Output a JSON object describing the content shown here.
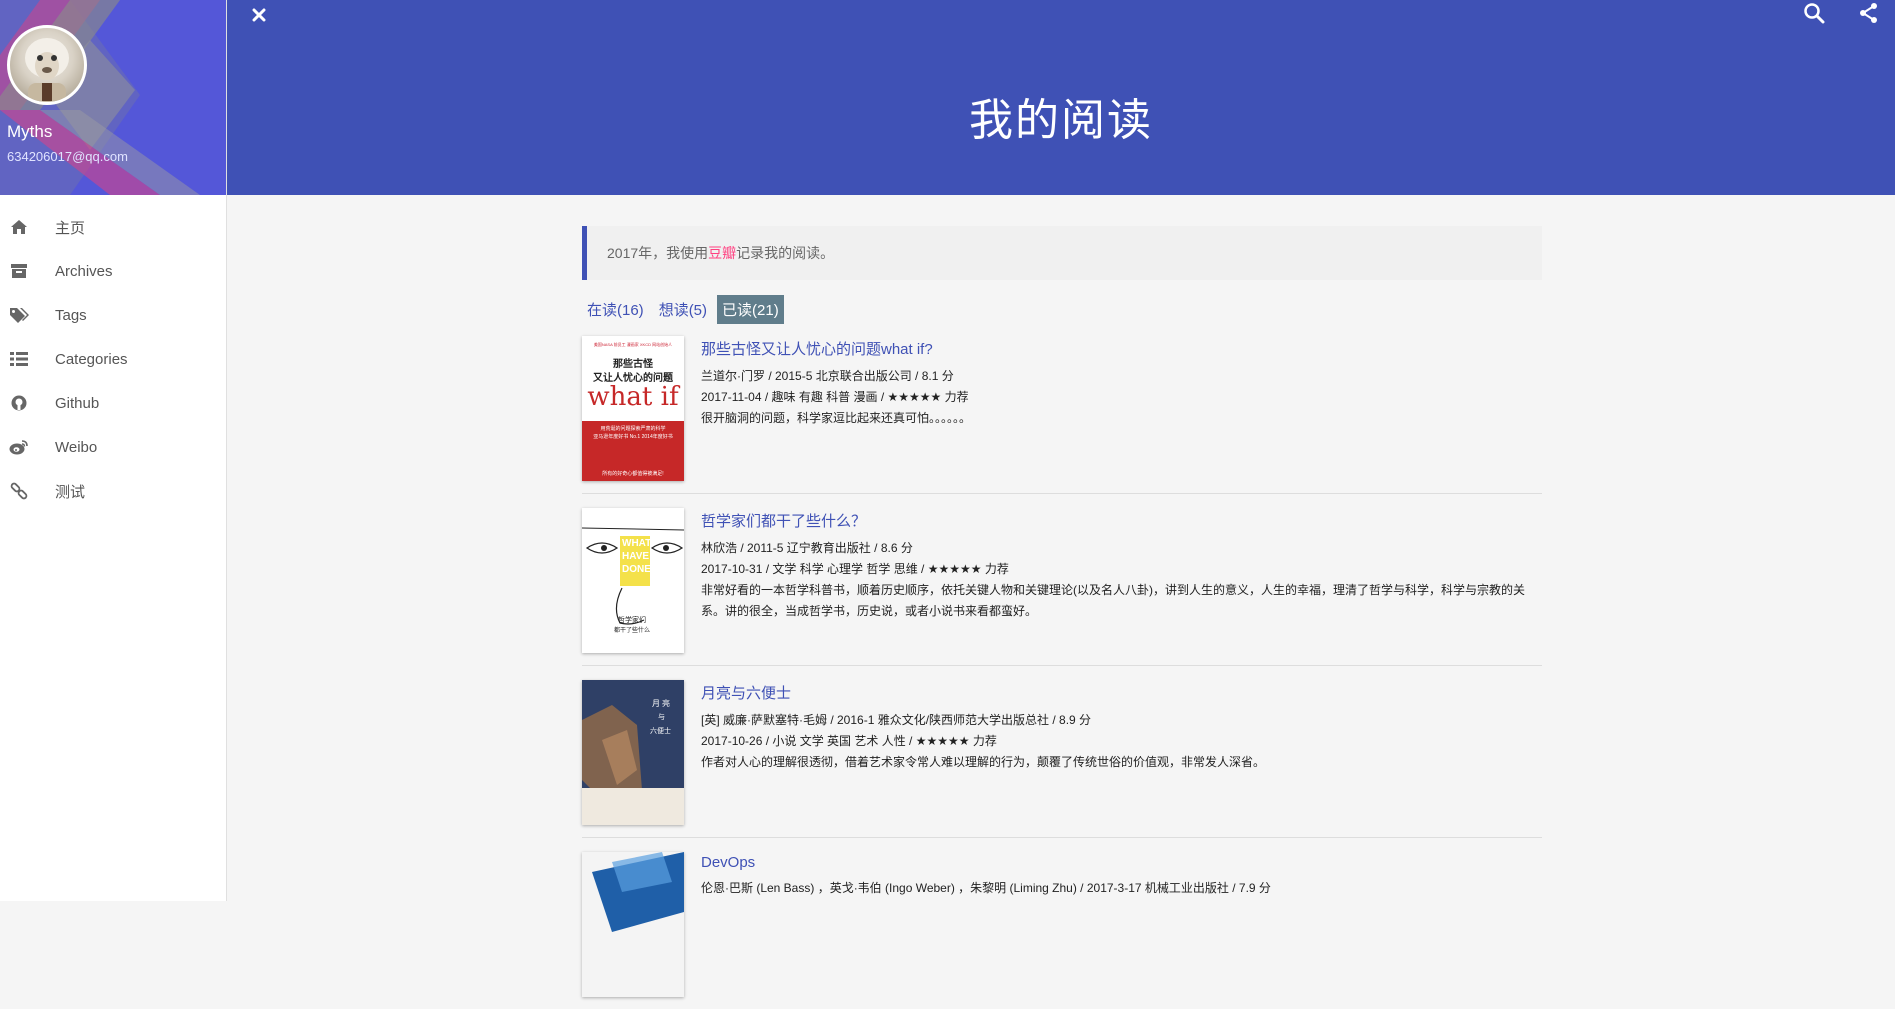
{
  "user": {
    "name": "Myths",
    "email": "634206017@qq.com"
  },
  "menu": [
    {
      "label": "主页",
      "icon": "home-icon"
    },
    {
      "label": "Archives",
      "icon": "archive-icon"
    },
    {
      "label": "Tags",
      "icon": "tags-icon"
    },
    {
      "label": "Categories",
      "icon": "list-icon"
    },
    {
      "label": "Github",
      "icon": "github-icon"
    },
    {
      "label": "Weibo",
      "icon": "weibo-icon"
    },
    {
      "label": "测试",
      "icon": "link-icon"
    }
  ],
  "header": {
    "title": "我的阅读"
  },
  "intro": {
    "before": "2017年，我使用",
    "link": "豆瓣",
    "after": "记录我的阅读。"
  },
  "tabs": [
    {
      "label": "在读(16)",
      "active": false
    },
    {
      "label": "想读(5)",
      "active": false
    },
    {
      "label": "已读(21)",
      "active": true
    }
  ],
  "books": [
    {
      "title": "那些古怪又让人忧心的问题what if?",
      "meta": "兰道尔·门罗 / 2015-5 北京联合出版公司 / 8.1 分",
      "tags": "2017-11-04 / 趣味 有趣 科普 漫画 / ★★★★★ 力荐",
      "comment": "很开脑洞的问题，科学家逗比起来还真可怕。。。。。。",
      "cover": {
        "top_text": "美国NASA 前员工 漫画家 XKCD 网站创始人",
        "line1": "那些古怪",
        "line2": "又让人忧心的问题",
        "big": "what if",
        "band1": "用荒诞的问题探索严肃的科学",
        "band2": "亚马逊年度好书 No.1  2014年度好书",
        "foot": "所有的好奇心都值得被满足!"
      }
    },
    {
      "title": "哲学家们都干了些什么？",
      "meta": "林欣浩 / 2011-5 辽宁教育出版社 / 8.6 分",
      "tags": "2017-10-31 / 文学 科学 心理学 哲学 思维 / ★★★★★ 力荐",
      "comment": "非常好看的一本哲学科普书，顺着历史顺序，依托关键人物和关键理论(以及名人八卦)，讲到人生的意义，人生的幸福，理清了哲学与科学，科学与宗教的关系。讲的很全，当成哲学书，历史说，或者小说书来看都蛮好。",
      "cover": {
        "word1": "WHAT",
        "word2": "HAVE",
        "word3": "DONE",
        "cn1": "哲学家们",
        "cn2": "都干了些什么"
      }
    },
    {
      "title": "月亮与六便士",
      "meta": "[英] 威廉·萨默塞特·毛姆 / 2016-1 雅众文化/陕西师范大学出版总社 / 8.9 分",
      "tags": "2017-10-26 / 小说 文学 英国 艺术 人性 / ★★★★★ 力荐",
      "comment": "作者对人心的理解很透彻，借着艺术家令常人难以理解的行为，颠覆了传统世俗的价值观，非常发人深省。",
      "cover": {
        "t1": "月",
        "t2": "亮",
        "t3": "与",
        "t4": "六便士"
      }
    },
    {
      "title": "DevOps",
      "meta": "伦恩·巴斯 (Len Bass) ，英戈·韦伯 (Ingo Weber) ，朱黎明 (Liming Zhu) / 2017-3-17 机械工业出版社 / 7.9 分",
      "tags": "",
      "comment": "",
      "cover": {}
    }
  ],
  "colors": {
    "primary": "#3f51b5",
    "accent": "#ff4081",
    "active_tab": "#607d8b"
  }
}
